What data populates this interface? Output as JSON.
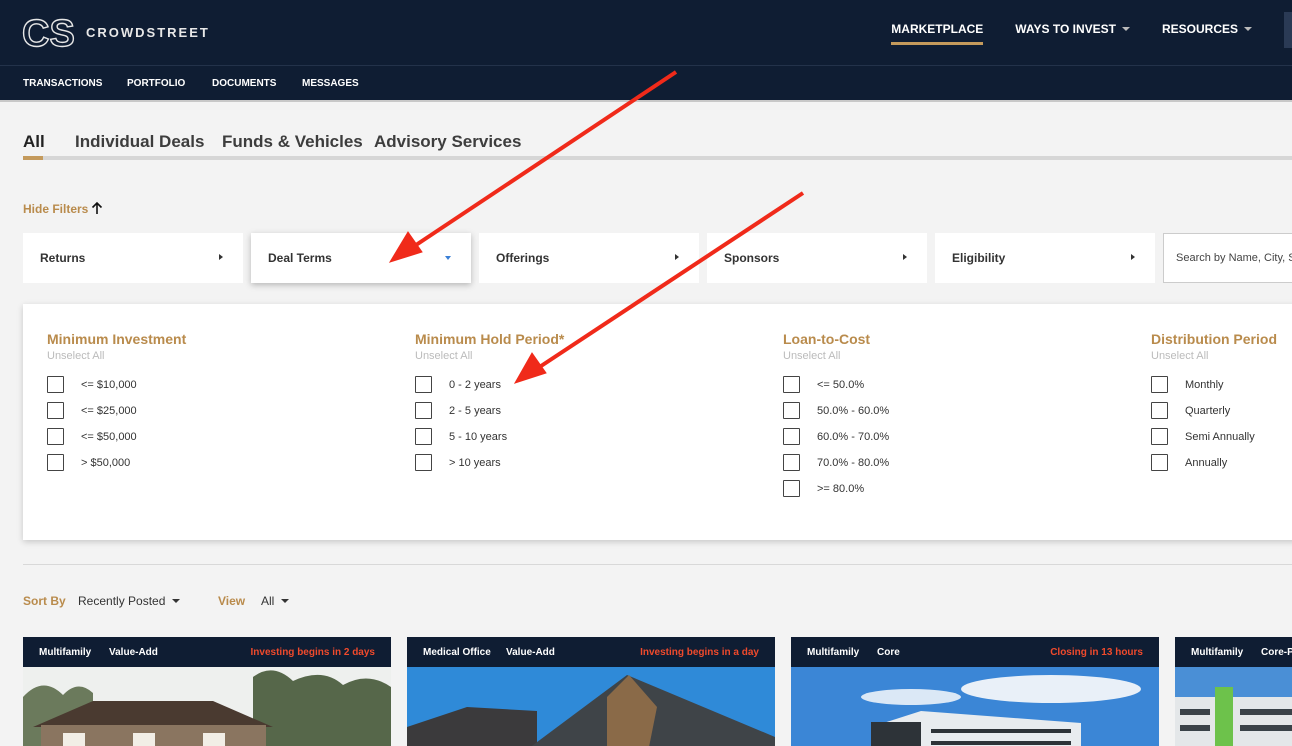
{
  "brand": {
    "logo_mark": "CS",
    "name": "CROWDSTREET"
  },
  "topnav": [
    {
      "label": "MARKETPLACE",
      "active": true,
      "dropdown": false
    },
    {
      "label": "WAYS TO INVEST",
      "active": false,
      "dropdown": true
    },
    {
      "label": "RESOURCES",
      "active": false,
      "dropdown": true
    }
  ],
  "subnav": [
    "TRANSACTIONS",
    "PORTFOLIO",
    "DOCUMENTS",
    "MESSAGES"
  ],
  "tabs": [
    {
      "label": "All",
      "active": true
    },
    {
      "label": "Individual Deals",
      "active": false
    },
    {
      "label": "Funds & Vehicles",
      "active": false
    },
    {
      "label": "Advisory Services",
      "active": false
    }
  ],
  "hide_filters": {
    "label": "Hide Filters",
    "icon": "arrow-up-icon"
  },
  "filter_cards": [
    {
      "label": "Returns",
      "open": false
    },
    {
      "label": "Deal Terms",
      "open": true
    },
    {
      "label": "Offerings",
      "open": false
    },
    {
      "label": "Sponsors",
      "open": false
    },
    {
      "label": "Eligibility",
      "open": false
    }
  ],
  "search": {
    "placeholder": "Search by Name, City, State"
  },
  "filter_groups": [
    {
      "title": "Minimum Investment",
      "unselect": "Unselect All",
      "options": [
        "<= $10,000",
        "<= $25,000",
        "<= $50,000",
        "> $50,000"
      ]
    },
    {
      "title": "Minimum Hold Period*",
      "unselect": "Unselect All",
      "options": [
        "0 - 2 years",
        "2 - 5 years",
        "5 - 10 years",
        "> 10 years"
      ]
    },
    {
      "title": "Loan-to-Cost",
      "unselect": "Unselect All",
      "options": [
        "<= 50.0%",
        "50.0% - 60.0%",
        "60.0% - 70.0%",
        "70.0% - 80.0%",
        ">= 80.0%"
      ]
    },
    {
      "title": "Distribution Period",
      "unselect": "Unselect All",
      "options": [
        "Monthly",
        "Quarterly",
        "Semi Annually",
        "Annually"
      ]
    }
  ],
  "sort": {
    "label": "Sort By",
    "value": "Recently Posted"
  },
  "view": {
    "label": "View",
    "value": "All"
  },
  "deals": [
    {
      "tags": [
        "Multifamily",
        "Value-Add"
      ],
      "status": "Investing begins in 2 days"
    },
    {
      "tags": [
        "Medical Office",
        "Value-Add"
      ],
      "status": "Investing begins in a day"
    },
    {
      "tags": [
        "Multifamily",
        "Core"
      ],
      "status": "Closing in 13 hours"
    },
    {
      "tags": [
        "Multifamily",
        "Core-Plus"
      ],
      "status": ""
    }
  ],
  "colors": {
    "navy": "#0f1d33",
    "gold": "#c49a5c",
    "status_red": "#f04a2c",
    "annotation_red": "#f02a1a"
  }
}
